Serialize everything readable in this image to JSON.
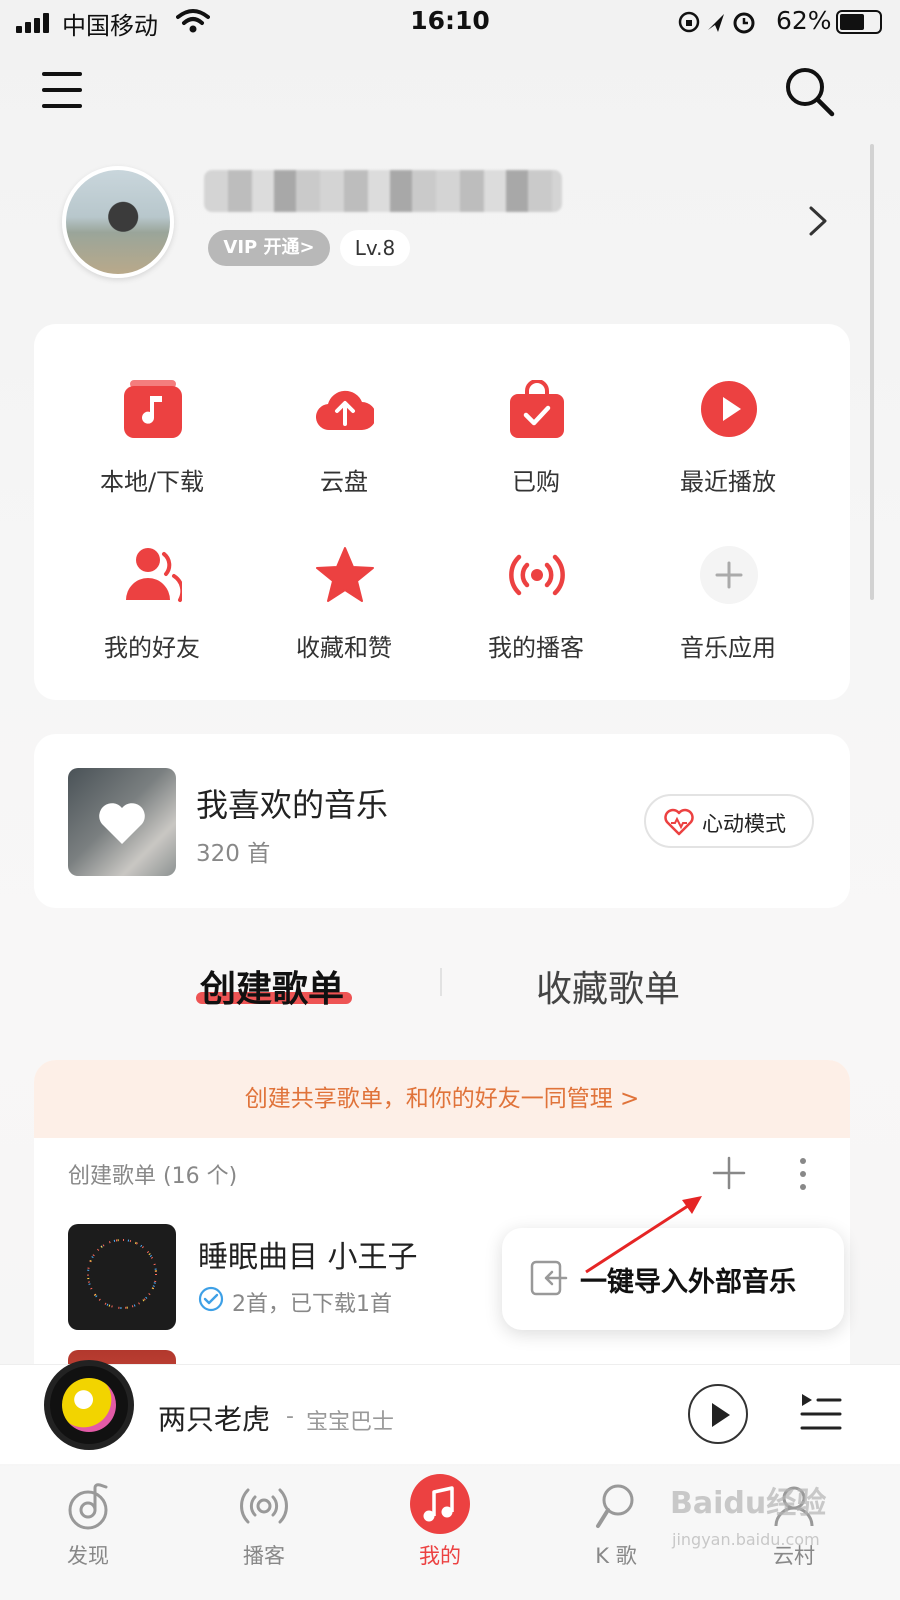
{
  "status_bar": {
    "carrier": "中国移动",
    "time": "16:10",
    "battery": "62%"
  },
  "profile": {
    "vip_label": "VIP 开通>",
    "level": "Lv.8"
  },
  "quick_grid": [
    {
      "label": "本地/下载",
      "icon": "music-note-icon"
    },
    {
      "label": "云盘",
      "icon": "cloud-upload-icon"
    },
    {
      "label": "已购",
      "icon": "shopping-bag-icon"
    },
    {
      "label": "最近播放",
      "icon": "play-circle-icon"
    },
    {
      "label": "我的好友",
      "icon": "friends-icon"
    },
    {
      "label": "收藏和赞",
      "icon": "star-icon"
    },
    {
      "label": "我的播客",
      "icon": "podcast-icon"
    },
    {
      "label": "音乐应用",
      "icon": "add-icon"
    }
  ],
  "liked_music": {
    "title": "我喜欢的音乐",
    "count": "320 首",
    "heartbeat_label": "心动模式"
  },
  "tabs": {
    "create": "创建歌单",
    "collect": "收藏歌单"
  },
  "playlists": {
    "shared_banner": "创建共享歌单，和你的好友一同管理 >",
    "section_header": "创建歌单 (16 个)",
    "items": [
      {
        "title": "睡眠曲目 小王子",
        "meta": "2首，已下载1首"
      }
    ]
  },
  "popup": {
    "label": "一键导入外部音乐"
  },
  "mini_player": {
    "title": "两只老虎",
    "separator": "-",
    "artist": "宝宝巴士"
  },
  "bottom_nav": [
    {
      "label": "发现",
      "icon": "discover-icon",
      "active": false
    },
    {
      "label": "播客",
      "icon": "podcast-icon",
      "active": false
    },
    {
      "label": "我的",
      "icon": "music-note-icon",
      "active": true
    },
    {
      "label": "K 歌",
      "icon": "microphone-icon",
      "active": false
    },
    {
      "label": "云村",
      "icon": "community-icon",
      "active": false
    }
  ],
  "watermark": {
    "text": "Baidu经验",
    "sub": "jingyan.baidu.com"
  },
  "colors": {
    "accent": "#ec4141",
    "banner_text": "#e0733a"
  }
}
